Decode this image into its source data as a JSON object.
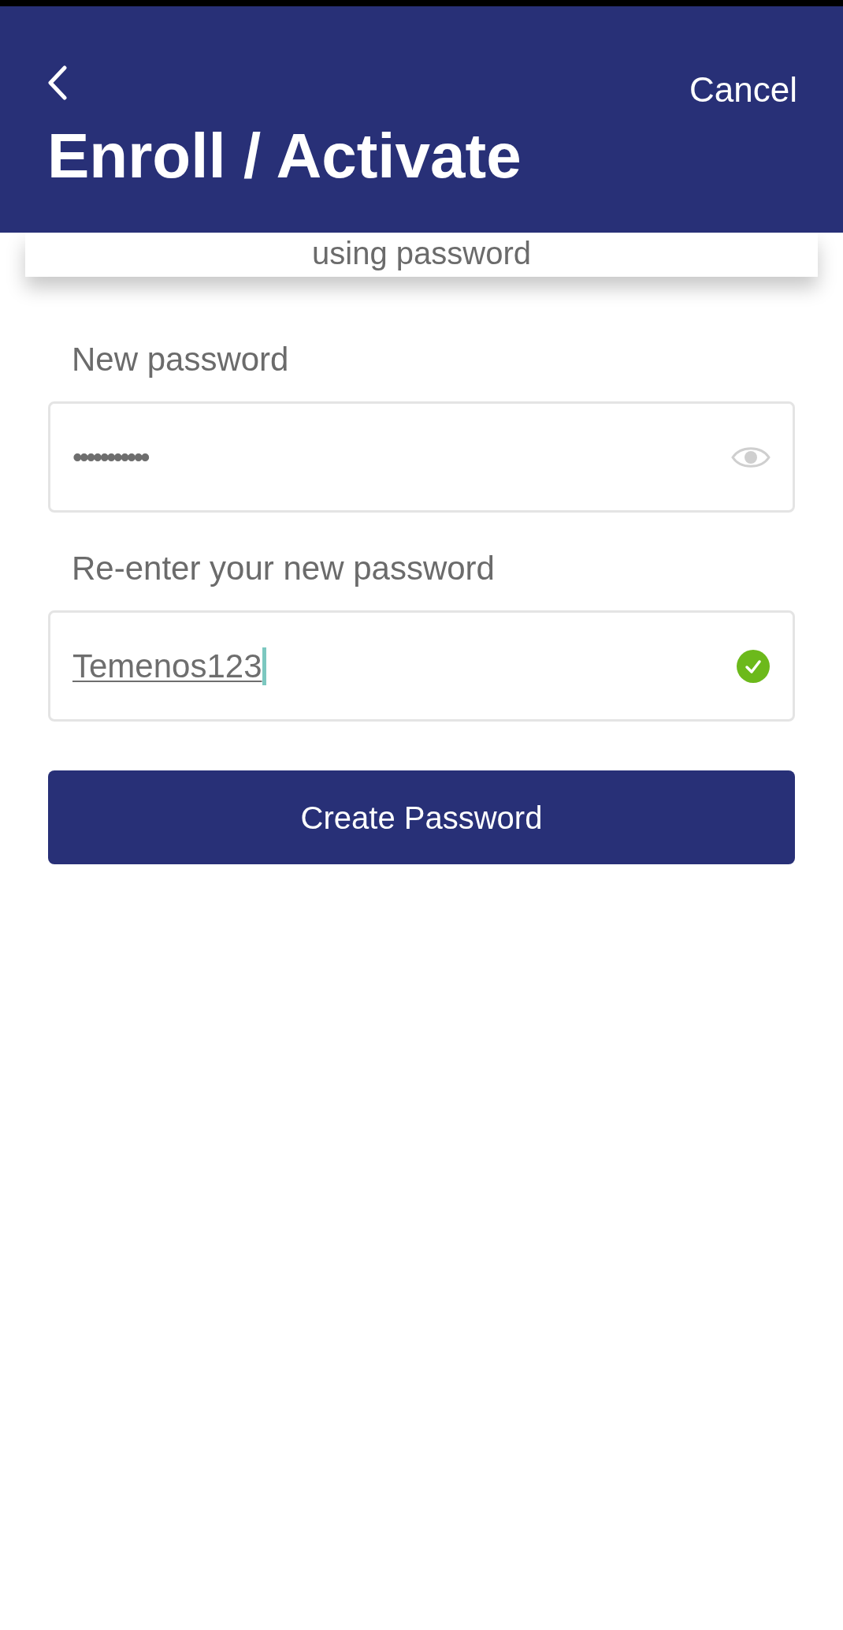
{
  "header": {
    "title": "Enroll / Activate",
    "cancel": "Cancel"
  },
  "card": {
    "text": "using password"
  },
  "fields": [
    {
      "label": "New password",
      "value": "•••••••••••",
      "kind": "password"
    },
    {
      "label": "Re-enter your new password",
      "value": "Temenos123",
      "kind": "confirm"
    }
  ],
  "button": {
    "label": "Create Password"
  }
}
